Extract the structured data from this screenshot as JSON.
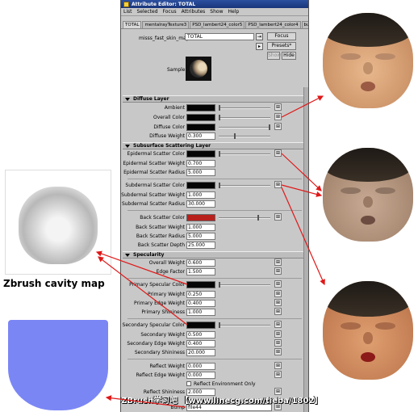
{
  "window": {
    "title": "Attribute Editor: TOTAL"
  },
  "menu": [
    "List",
    "Selected",
    "Focus",
    "Attributes",
    "Show",
    "Help"
  ],
  "tabs": [
    "TOTAL",
    "mentalrayTexture3",
    "PSD_lambert24_color5",
    "PSD_lambert24_color4",
    "bu"
  ],
  "node": {
    "type_label": "misss_fast_skin_maya:",
    "name": "TOTAL"
  },
  "buttons": {
    "focus": "Focus",
    "presets": "Presets*",
    "show": "Show",
    "hide": "Hide"
  },
  "sample_label": "Sample",
  "diffuse": {
    "title": "Diffuse Layer",
    "ambient_label": "Ambient",
    "overall_color_label": "Overall Color",
    "diffuse_color_label": "Diffuse Color",
    "diffuse_weight_label": "Diffuse Weight",
    "diffuse_weight": "0.300"
  },
  "sss": {
    "title": "Subsurface Scattering Layer",
    "epi_color_label": "Epidermal Scatter Color",
    "epi_weight_label": "Epidermal Scatter Weight",
    "epi_weight": "0.700",
    "epi_radius_label": "Epidermal Scatter Radius",
    "epi_radius": "5.000",
    "sub_color_label": "Subdermal Scatter Color",
    "sub_weight_label": "Subdermal Scatter Weight",
    "sub_weight": "1.000",
    "sub_radius_label": "Subdermal Scatter Radius",
    "sub_radius": "30.000",
    "back_color_label": "Back Scatter Color",
    "back_color": "#b8201c",
    "back_weight_label": "Back Scatter Weight",
    "back_weight": "1.000",
    "back_radius_label": "Back Scatter Radius",
    "back_radius": "5.000",
    "back_depth_label": "Back Scatter Depth",
    "back_depth": "25.000"
  },
  "spec": {
    "title": "Specularity",
    "overall_weight_label": "Overall Weight",
    "overall_weight": "0.600",
    "edge_factor_label": "Edge Factor",
    "edge_factor": "1.500",
    "primary_color_label": "Primary Specular Color",
    "primary_weight_label": "Primary Weight",
    "primary_weight": "0.250",
    "primary_edge_label": "Primary Edge Weight",
    "primary_edge": "0.400",
    "primary_shininess_label": "Primary Shininess",
    "primary_shininess": "1.000",
    "secondary_color_label": "Secondary Specular Color",
    "secondary_weight_label": "Secondary Weight",
    "secondary_weight": "0.500",
    "secondary_edge_label": "Secondary Edge Weight",
    "secondary_edge": "0.400",
    "secondary_shininess_label": "Secondary Shininess",
    "secondary_shininess": "20.000",
    "reflect_weight_label": "Reflect Weight",
    "reflect_weight": "0.000",
    "reflect_edge_label": "Reflect Edge Weight",
    "reflect_edge": "0.000",
    "reflect_env_label": "Reflect Environment Only",
    "reflect_shininess_label": "Reflect Shininess",
    "reflect_shininess": "2.000",
    "bump_label": "Bump",
    "bump": "file44"
  },
  "cavity_caption": "Zbrush cavity map",
  "footer_text": "ZBrush学习吧 【www.linecg.com/tieba/1802】",
  "colors": {
    "arrow": "#e01818",
    "normal_map": "#7b86f5"
  }
}
